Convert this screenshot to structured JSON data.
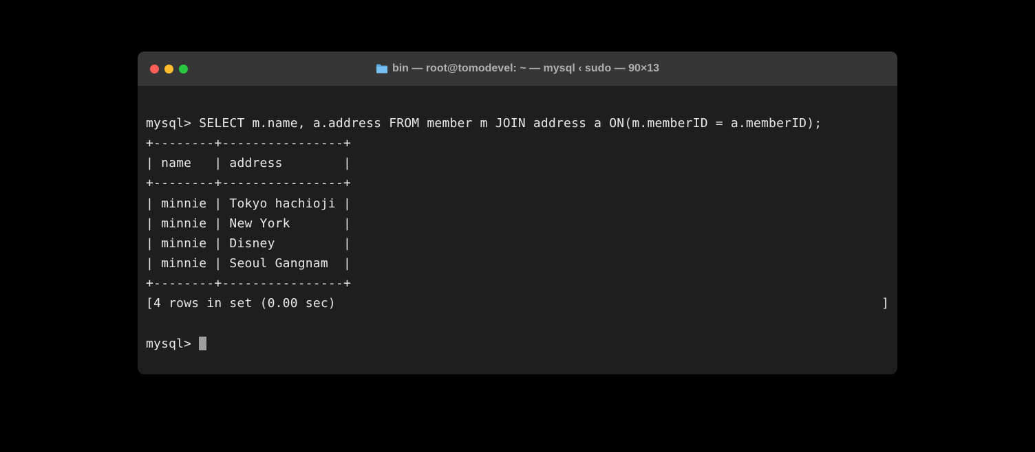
{
  "window": {
    "title": "bin — root@tomodevel: ~ — mysql ‹ sudo — 90×13",
    "icon": "folder-icon"
  },
  "terminal": {
    "prompt": "mysql> ",
    "query": "SELECT m.name, a.address FROM member m JOIN address a ON(m.memberID = a.memberID);",
    "table_border_top": "+--------+----------------+",
    "table_header": "| name   | address        |",
    "table_border_mid": "+--------+----------------+",
    "table_rows": [
      "| minnie | Tokyo hachioji |",
      "| minnie | New York       |",
      "| minnie | Disney         |",
      "| minnie | Seoul Gangnam  |"
    ],
    "table_border_bot": "+--------+----------------+",
    "footer_open": "[",
    "footer_text": "4 rows in set (0.00 sec)",
    "footer_close": "]",
    "prompt2": "mysql> "
  },
  "chart_data": {
    "type": "table",
    "columns": [
      "name",
      "address"
    ],
    "rows": [
      [
        "minnie",
        "Tokyo hachioji"
      ],
      [
        "minnie",
        "New York"
      ],
      [
        "minnie",
        "Disney"
      ],
      [
        "minnie",
        "Seoul Gangnam"
      ]
    ],
    "row_count": 4,
    "elapsed_sec": 0.0,
    "query": "SELECT m.name, a.address FROM member m JOIN address a ON(m.memberID = a.memberID);"
  }
}
